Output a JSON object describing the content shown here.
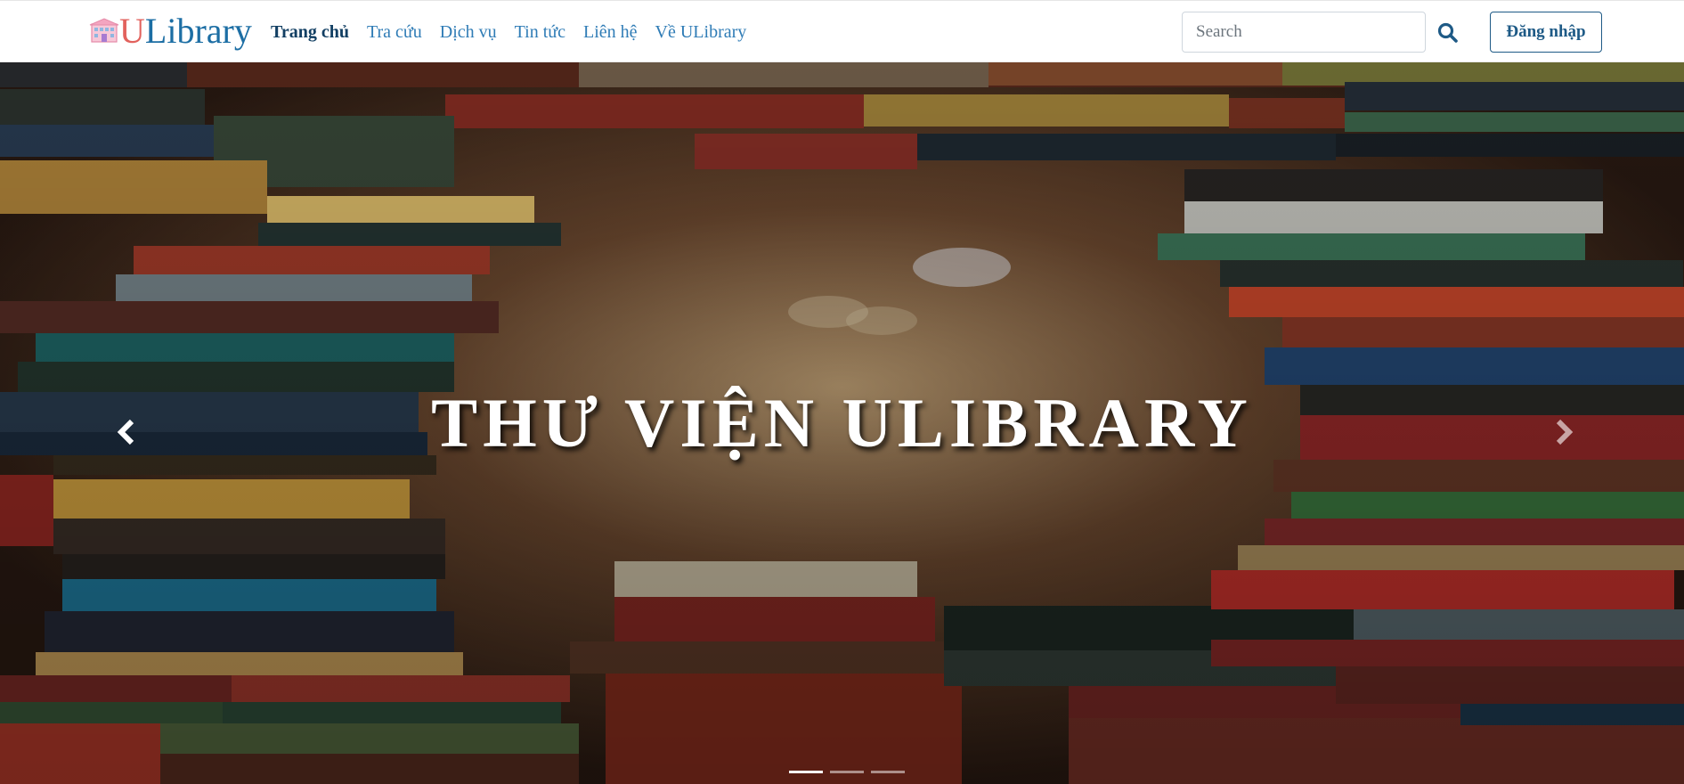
{
  "brand": {
    "initial": "U",
    "rest": "Library",
    "logo_icon": "library-building-icon"
  },
  "nav": {
    "items": [
      {
        "label": "Trang chủ",
        "active": true
      },
      {
        "label": "Tra cứu",
        "active": false
      },
      {
        "label": "Dịch vụ",
        "active": false
      },
      {
        "label": "Tin tức",
        "active": false
      },
      {
        "label": "Liên hệ",
        "active": false
      },
      {
        "label": "Về ULibrary",
        "active": false
      }
    ]
  },
  "search": {
    "placeholder": "Search",
    "value": "",
    "icon": "search-icon"
  },
  "login": {
    "label": "Đăng nhập"
  },
  "hero": {
    "title": "THƯ VIỆN ULIBRARY",
    "prev_icon": "chevron-left-icon",
    "next_icon": "chevron-right-icon",
    "slides_count": 3,
    "active_slide": 1
  },
  "colors": {
    "brand_blue": "#1c6ea4",
    "brand_red": "#e2625d",
    "nav_link": "#2f7cb6",
    "active_link": "#123f63"
  }
}
